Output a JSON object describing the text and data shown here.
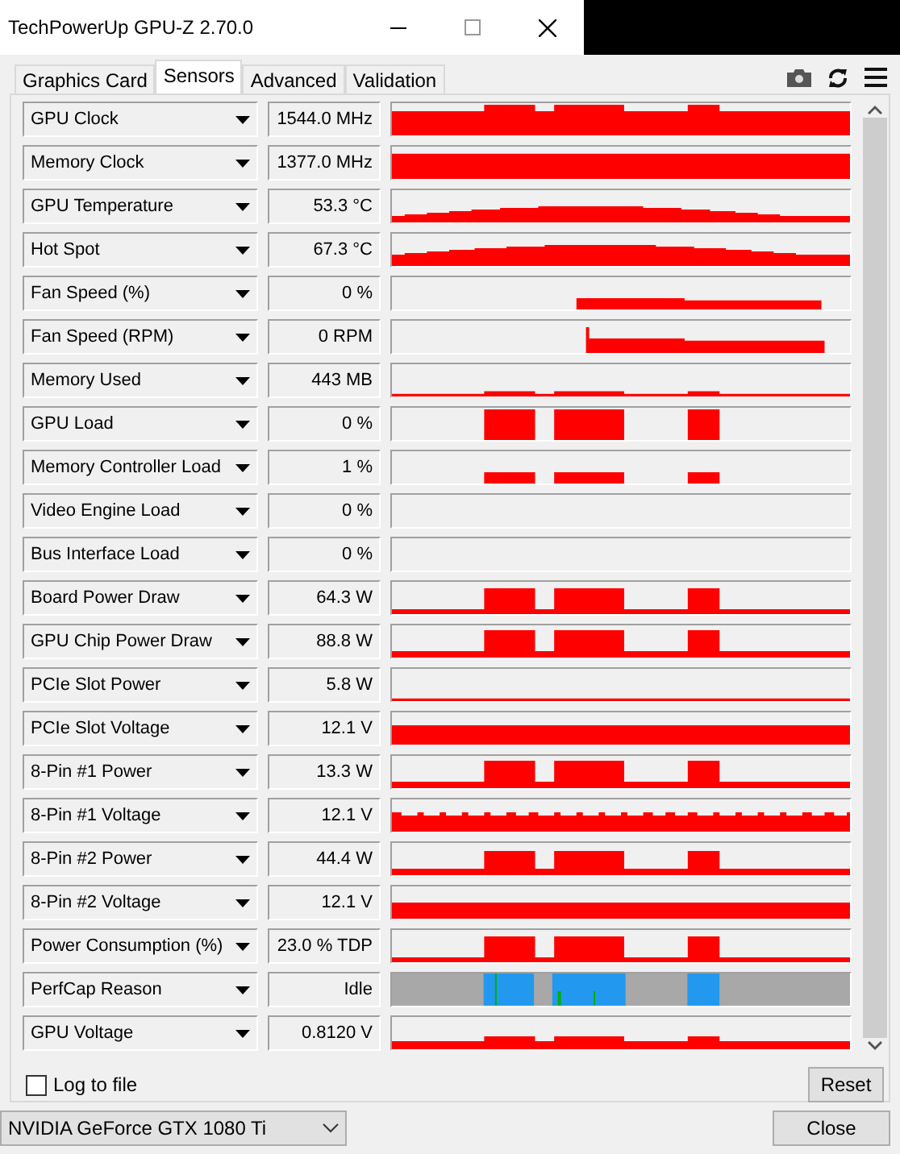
{
  "window": {
    "title": "TechPowerUp GPU-Z 2.70.0"
  },
  "tabs": [
    {
      "label": "Graphics Card",
      "selected": false
    },
    {
      "label": "Sensors",
      "selected": true
    },
    {
      "label": "Advanced",
      "selected": false
    },
    {
      "label": "Validation",
      "selected": false
    }
  ],
  "sensors": [
    {
      "name": "GPU Clock",
      "value": "1544.0 MHz",
      "kind": "graph"
    },
    {
      "name": "Memory Clock",
      "value": "1377.0 MHz",
      "kind": "graph"
    },
    {
      "name": "GPU Temperature",
      "value": "53.3 °C",
      "kind": "graph"
    },
    {
      "name": "Hot Spot",
      "value": "67.3 °C",
      "kind": "graph"
    },
    {
      "name": "Fan Speed (%)",
      "value": "0 %",
      "kind": "graph"
    },
    {
      "name": "Fan Speed (RPM)",
      "value": "0 RPM",
      "kind": "graph"
    },
    {
      "name": "Memory Used",
      "value": "443 MB",
      "kind": "graph"
    },
    {
      "name": "GPU Load",
      "value": "0 %",
      "kind": "graph"
    },
    {
      "name": "Memory Controller Load",
      "value": "1 %",
      "kind": "graph"
    },
    {
      "name": "Video Engine Load",
      "value": "0 %",
      "kind": "graph"
    },
    {
      "name": "Bus Interface Load",
      "value": "0 %",
      "kind": "graph"
    },
    {
      "name": "Board Power Draw",
      "value": "64.3 W",
      "kind": "graph"
    },
    {
      "name": "GPU Chip Power Draw",
      "value": "88.8 W",
      "kind": "graph"
    },
    {
      "name": "PCIe Slot Power",
      "value": "5.8 W",
      "kind": "graph"
    },
    {
      "name": "PCIe Slot Voltage",
      "value": "12.1 V",
      "kind": "graph"
    },
    {
      "name": "8-Pin #1 Power",
      "value": "13.3 W",
      "kind": "graph"
    },
    {
      "name": "8-Pin #1 Voltage",
      "value": "12.1 V",
      "kind": "graph"
    },
    {
      "name": "8-Pin #2 Power",
      "value": "44.4 W",
      "kind": "graph"
    },
    {
      "name": "8-Pin #2 Voltage",
      "value": "12.1 V",
      "kind": "graph"
    },
    {
      "name": "Power Consumption (%)",
      "value": "23.0 % TDP",
      "kind": "graph"
    },
    {
      "name": "PerfCap Reason",
      "value": "Idle",
      "kind": "perfcap"
    },
    {
      "name": "GPU Voltage",
      "value": "0.8120 V",
      "kind": "graph"
    }
  ],
  "log_to_file": {
    "label": "Log to file",
    "checked": false
  },
  "reset_button": "Reset",
  "device": "NVIDIA GeForce GTX 1080 Ti",
  "close_button": "Close"
}
